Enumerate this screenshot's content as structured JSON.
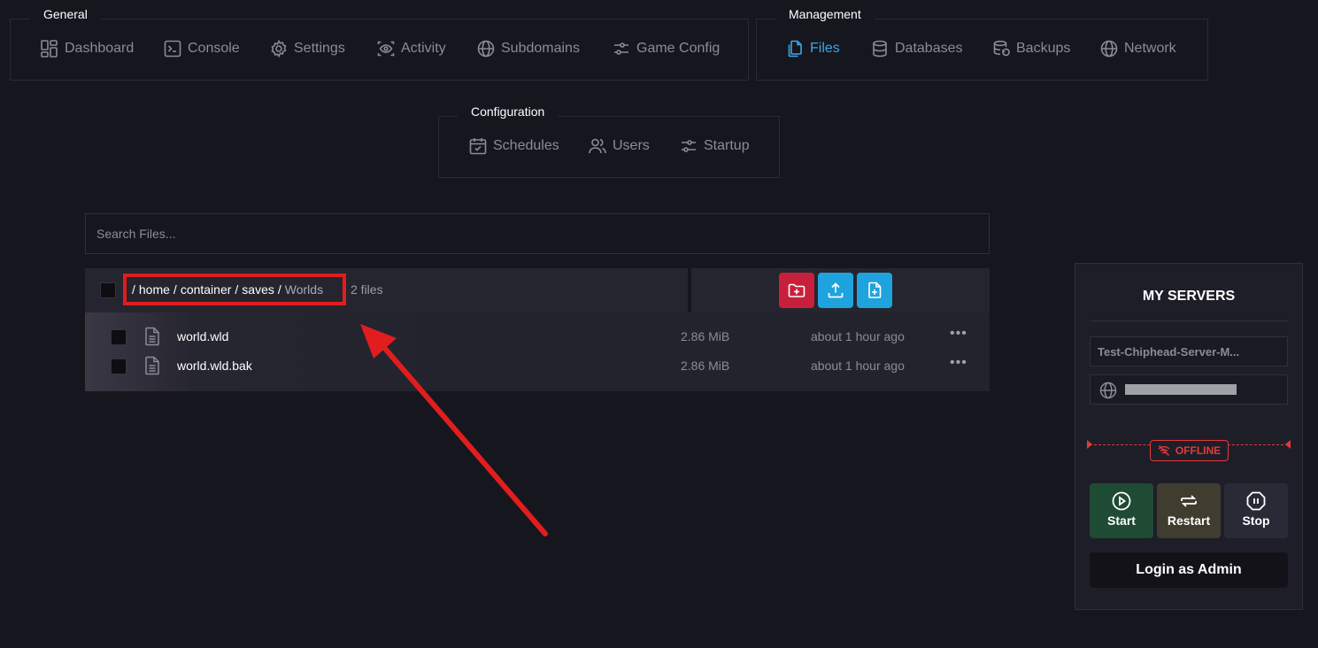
{
  "nav": {
    "general": {
      "legend": "General",
      "items": [
        {
          "label": "Dashboard",
          "icon": "dashboard-icon"
        },
        {
          "label": "Console",
          "icon": "console-icon"
        },
        {
          "label": "Settings",
          "icon": "gear-icon"
        },
        {
          "label": "Activity",
          "icon": "eye-icon"
        },
        {
          "label": "Subdomains",
          "icon": "globe-icon"
        },
        {
          "label": "Game Config",
          "icon": "sliders-icon"
        }
      ]
    },
    "management": {
      "legend": "Management",
      "items": [
        {
          "label": "Files",
          "icon": "files-icon",
          "active": true
        },
        {
          "label": "Databases",
          "icon": "database-icon"
        },
        {
          "label": "Backups",
          "icon": "backup-icon"
        },
        {
          "label": "Network",
          "icon": "globe-icon"
        }
      ]
    },
    "configuration": {
      "legend": "Configuration",
      "items": [
        {
          "label": "Schedules",
          "icon": "calendar-icon"
        },
        {
          "label": "Users",
          "icon": "users-icon"
        },
        {
          "label": "Startup",
          "icon": "sliders-icon"
        }
      ]
    }
  },
  "search": {
    "placeholder": "Search Files..."
  },
  "file_manager": {
    "breadcrumb": {
      "separator": "/",
      "parts": [
        "home",
        "container",
        "saves"
      ],
      "current": "Worlds"
    },
    "file_count": "2 files",
    "actions": [
      {
        "name": "new-folder",
        "icon": "folder-plus-icon",
        "color": "#c8203c"
      },
      {
        "name": "upload",
        "icon": "upload-icon",
        "color": "#1fa3de"
      },
      {
        "name": "new-file",
        "icon": "file-plus-icon",
        "color": "#1fa3de"
      }
    ],
    "files": [
      {
        "name": "world.wld",
        "size": "2.86 MiB",
        "modified": "about 1 hour ago",
        "menu": "•••"
      },
      {
        "name": "world.wld.bak",
        "size": "2.86 MiB",
        "modified": "about 1 hour ago",
        "menu": "•••"
      }
    ]
  },
  "annotation": {
    "highlight_color": "#e11d1d"
  },
  "servers_panel": {
    "title": "MY SERVERS",
    "server_name": "Test-Chiphead-Server-M...",
    "status": "OFFLINE",
    "status_color": "#e23a3a",
    "buttons": {
      "start": {
        "label": "Start",
        "color": "#1f4a34"
      },
      "restart": {
        "label": "Restart",
        "color": "#403d30"
      },
      "stop": {
        "label": "Stop",
        "color": "#2a2a36"
      }
    },
    "login_admin": "Login as Admin"
  },
  "colors": {
    "background": "#16161f",
    "accent": "#3fa4e6",
    "muted_text": "#8a8c96"
  }
}
